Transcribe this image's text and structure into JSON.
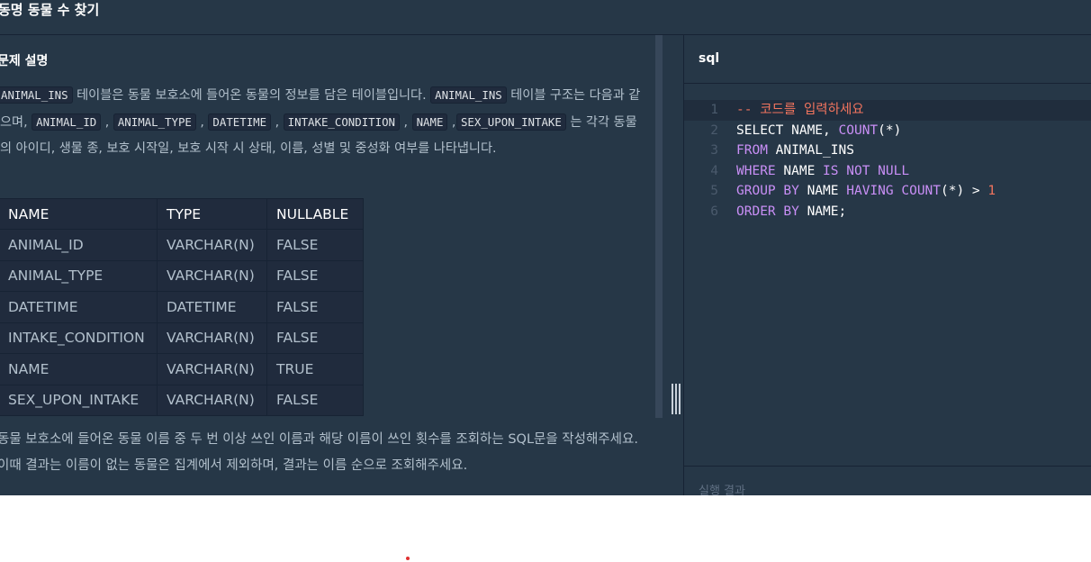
{
  "page_title": "동명 동물 수 찾기",
  "problem": {
    "section_title": "문제 설명",
    "desc": {
      "code_animal_ins_1": "ANIMAL_INS",
      "text1": " 테이블은 동물 보호소에 들어온 동물의 정보를 담은 테이블입니다. ",
      "code_animal_ins_2": "ANIMAL_INS",
      "text2": " 테이블 구조는 다음과 같으며, ",
      "code_animal_id": "ANIMAL_ID",
      "code_animal_type": "ANIMAL_TYPE",
      "code_datetime": "DATETIME",
      "code_intake_condition": "INTAKE_CONDITION",
      "code_name": "NAME",
      "code_sex_upon_intake": "SEX_UPON_INTAKE",
      "sep": ",",
      "text3": " 는 각각 동물의 아이디, 생물 종, 보호 시작일, 보호 시작 시 상태, 이름, 성별 및 중성화 여부를 나타냅니다."
    },
    "table": {
      "headers": [
        "NAME",
        "TYPE",
        "NULLABLE"
      ],
      "rows": [
        [
          "ANIMAL_ID",
          "VARCHAR(N)",
          "FALSE"
        ],
        [
          "ANIMAL_TYPE",
          "VARCHAR(N)",
          "FALSE"
        ],
        [
          "DATETIME",
          "DATETIME",
          "FALSE"
        ],
        [
          "INTAKE_CONDITION",
          "VARCHAR(N)",
          "FALSE"
        ],
        [
          "NAME",
          "VARCHAR(N)",
          "TRUE"
        ],
        [
          "SEX_UPON_INTAKE",
          "VARCHAR(N)",
          "FALSE"
        ]
      ]
    },
    "task": "동물 보호소에 들어온 동물 이름 중 두 번 이상 쓰인 이름과 해당 이름이 쓰인 횟수를 조회하는 SQL문을 작성해주세요. 이때 결과는 이름이 없는 동물은 집계에서 제외하며, 결과는 이름 순으로 조회해주세요."
  },
  "editor": {
    "language": "sql",
    "lines": [
      {
        "n": "1",
        "parts": [
          {
            "t": "-- 코드를 입력하세요",
            "c": "comment"
          }
        ]
      },
      {
        "n": "2",
        "parts": [
          {
            "t": "SELECT",
            "c": "plain"
          },
          {
            "t": " NAME, ",
            "c": "plain"
          },
          {
            "t": "COUNT",
            "c": "kw"
          },
          {
            "t": "(*)",
            "c": "plain"
          }
        ]
      },
      {
        "n": "3",
        "parts": [
          {
            "t": "FROM",
            "c": "kw"
          },
          {
            "t": " ANIMAL_INS",
            "c": "plain"
          }
        ]
      },
      {
        "n": "4",
        "parts": [
          {
            "t": "WHERE",
            "c": "kw"
          },
          {
            "t": " NAME ",
            "c": "plain"
          },
          {
            "t": "IS NOT",
            "c": "kw"
          },
          {
            "t": " ",
            "c": "plain"
          },
          {
            "t": "NULL",
            "c": "null"
          }
        ]
      },
      {
        "n": "5",
        "parts": [
          {
            "t": "GROUP BY",
            "c": "kw"
          },
          {
            "t": " NAME ",
            "c": "plain"
          },
          {
            "t": "HAVING",
            "c": "kw"
          },
          {
            "t": " ",
            "c": "plain"
          },
          {
            "t": "COUNT",
            "c": "kw"
          },
          {
            "t": "(*) > ",
            "c": "plain"
          },
          {
            "t": "1",
            "c": "num"
          }
        ]
      },
      {
        "n": "6",
        "parts": [
          {
            "t": "ORDER BY",
            "c": "kw"
          },
          {
            "t": " NAME;",
            "c": "plain"
          }
        ]
      }
    ]
  },
  "result_label": "실행 결과",
  "colors": {
    "background": "#263747",
    "border": "#172334",
    "keyword": "#c98ff6",
    "comment": "#f1745e",
    "text": "#b2c0cc"
  }
}
